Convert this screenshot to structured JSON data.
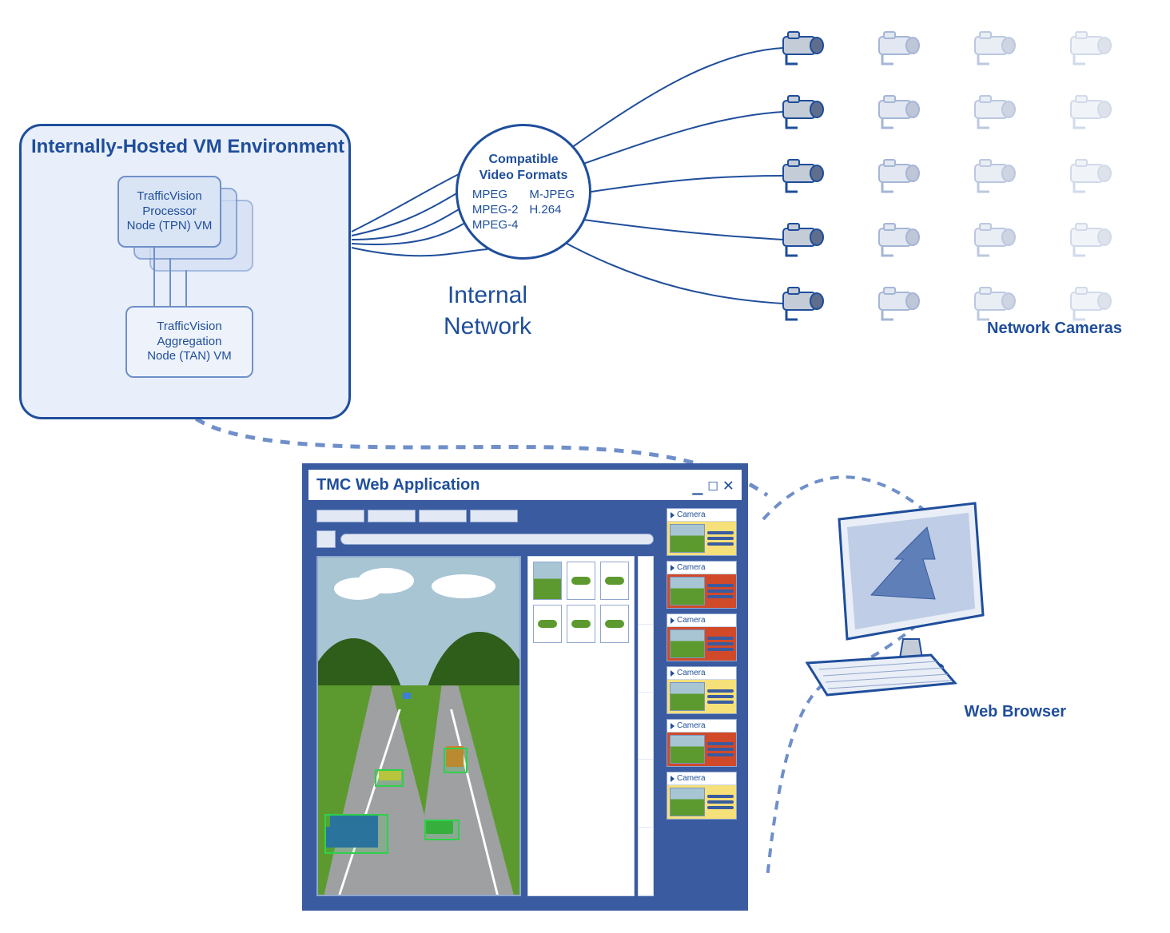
{
  "vm_environment": {
    "title": "Internally-Hosted VM Environment",
    "tpn": {
      "line1": "TrafficVision",
      "line2": "Processor",
      "line3": "Node (TPN) VM"
    },
    "tan": {
      "line1": "TrafficVision",
      "line2": "Aggregation",
      "line3": "Node (TAN) VM"
    }
  },
  "video_formats": {
    "title_line1": "Compatible",
    "title_line2": "Video Formats",
    "items": [
      "MPEG",
      "M-JPEG",
      "MPEG-2",
      "H.264",
      "MPEG-4",
      ""
    ]
  },
  "internal_network": {
    "line1": "Internal",
    "line2": "Network"
  },
  "network_cameras_label": "Network Cameras",
  "app": {
    "title": "TMC Web Application",
    "camera_label": "Camera",
    "camera_panels": [
      {
        "variant": "yellow"
      },
      {
        "variant": "red"
      },
      {
        "variant": "red"
      },
      {
        "variant": "yellow"
      },
      {
        "variant": "red"
      },
      {
        "variant": "yellow"
      }
    ]
  },
  "web_browser_label": "Web Browser"
}
